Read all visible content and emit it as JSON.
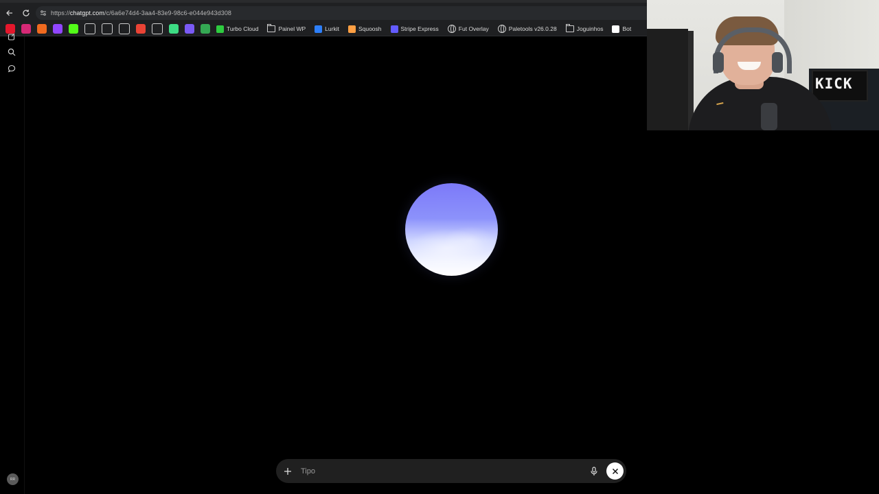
{
  "browser": {
    "url_prefix": "https://",
    "url_host": "chatgpt.com",
    "url_path": "/c/6a6e74d4-3aa4-83e9-98c6-e044e943d308"
  },
  "bookmarks": {
    "icon_colors": [
      "#e5172c",
      "#d62976",
      "#f06a1f",
      "#9146ff",
      "#53fc18",
      "#ffffff",
      "#ffffff",
      "#ffffff",
      "#ea4335",
      "#ffffff",
      "#3ddc84",
      "#7a5af5",
      "#34a853"
    ],
    "items": [
      {
        "label": "Turbo Cloud",
        "type": "link",
        "icon_color": "#2ecc40"
      },
      {
        "label": "Painel WP",
        "type": "folder"
      },
      {
        "label": "Lurkit",
        "type": "link",
        "icon_color": "#2d7ff9"
      },
      {
        "label": "Squoosh",
        "type": "link",
        "icon_color": "#ff9f43"
      },
      {
        "label": "Stripe Express",
        "type": "link",
        "icon_color": "#635bff"
      },
      {
        "label": "Fut Overlay",
        "type": "globe"
      },
      {
        "label": "Paletools v26.0.28",
        "type": "globe"
      },
      {
        "label": "Joguinhos",
        "type": "folder"
      },
      {
        "label": "Bot",
        "type": "link",
        "icon_color": "#ffffff"
      }
    ]
  },
  "sidebar": {
    "icons": [
      "new-chat-icon",
      "search-icon",
      "chat-bubble-icon"
    ],
    "avatar_initials": "RR"
  },
  "voice": {
    "orb_colors": [
      "#7c79f8",
      "#cfd6ff",
      "#ffffff"
    ]
  },
  "composer": {
    "placeholder": "Tipo",
    "value": ""
  },
  "webcam": {
    "sign_text": "KICK"
  }
}
